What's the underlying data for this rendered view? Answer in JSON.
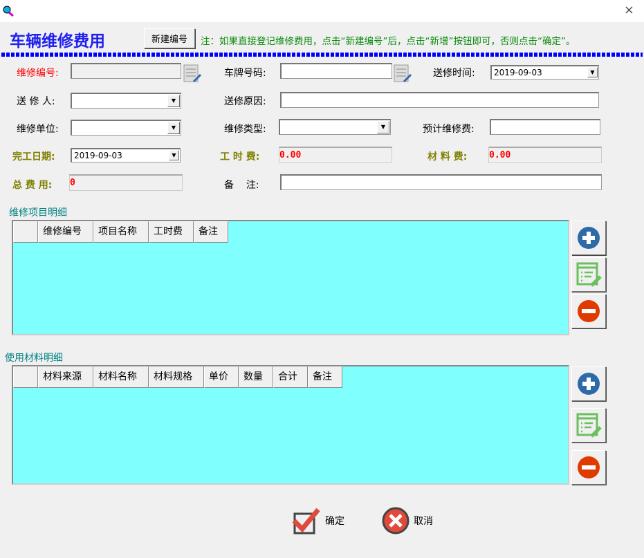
{
  "window": {
    "title_icon": "magnifier-icon",
    "close": "×"
  },
  "header": {
    "title": "车辆维修费用",
    "new_number_button": "新建编号",
    "note": "注：如果直接登记维修费用，点击“新建编号”后，点击“新增”按钮即可，否则点击“确定”。"
  },
  "form": {
    "repair_no": {
      "label": "维修编号:",
      "value": ""
    },
    "plate_no": {
      "label": "车牌号码:",
      "value": ""
    },
    "send_time": {
      "label": "送修时间:",
      "value": "2019-09-03"
    },
    "sender": {
      "label": "送 修 人:",
      "value": ""
    },
    "reason": {
      "label": "送修原因:",
      "value": ""
    },
    "unit": {
      "label": "维修单位:",
      "value": ""
    },
    "type": {
      "label": "维修类型:",
      "value": ""
    },
    "estimate": {
      "label": "预计维修费:",
      "value": ""
    },
    "finish_date": {
      "label": "完工日期:",
      "value": "2019-09-03"
    },
    "labor_fee": {
      "label": "工 时 费:",
      "value": "0.00"
    },
    "material_fee": {
      "label": "材 料 费:",
      "value": "0.00"
    },
    "total": {
      "label": "总 费 用:",
      "value": "0"
    },
    "remark": {
      "label": "备    注:",
      "value": ""
    }
  },
  "items_section": {
    "title": "维修项目明细",
    "columns": [
      "",
      "维修编号",
      "项目名称",
      "工时费",
      "备注"
    ]
  },
  "materials_section": {
    "title": "使用材料明细",
    "columns": [
      "",
      "材料来源",
      "材料名称",
      "材料规格",
      "单价",
      "数量",
      "合计",
      "备注"
    ]
  },
  "buttons": {
    "ok": "确定",
    "cancel": "取消"
  },
  "colors": {
    "accent": "#0000ff",
    "grid": "#80ffff",
    "note": "#0a8a0a"
  }
}
